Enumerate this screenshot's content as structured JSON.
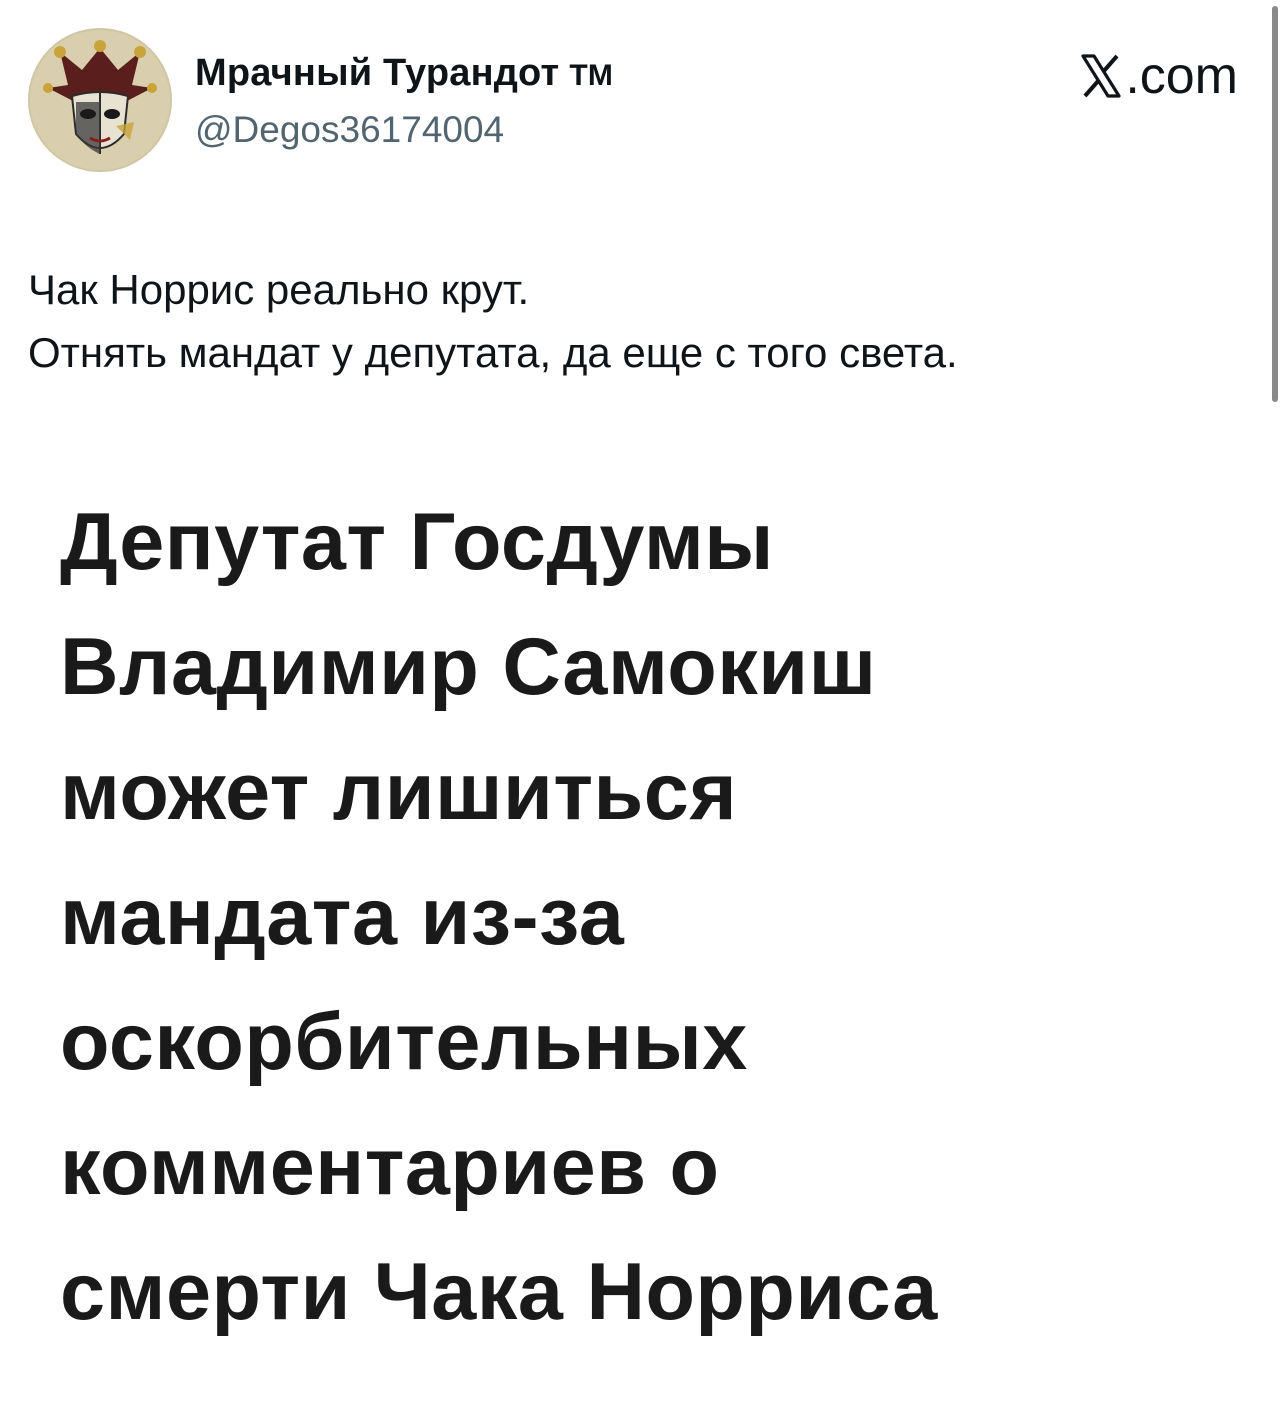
{
  "tweet": {
    "author": {
      "display_name": "Мрачный Турандот",
      "trademark": "TM",
      "handle": "@Degos36174004",
      "avatar_icon": "jester-mask-avatar"
    },
    "brand": {
      "icon": "x-logo-icon",
      "label": ".com"
    },
    "text_lines": [
      "Чак Норрис реально крут.",
      "Отнять мандат у депутата, да еще с того света."
    ],
    "media": {
      "headline_lines": [
        "Депутат Госдумы",
        "Владимир Самокиш",
        "может лишиться",
        "мандата из-за",
        "оскорбительных",
        "комментариев о",
        "смерти Чака Норриса"
      ]
    }
  },
  "colors": {
    "text": "#0f1419",
    "secondary_text": "#536471",
    "headline_text": "#1a1a1a",
    "background": "#ffffff"
  }
}
